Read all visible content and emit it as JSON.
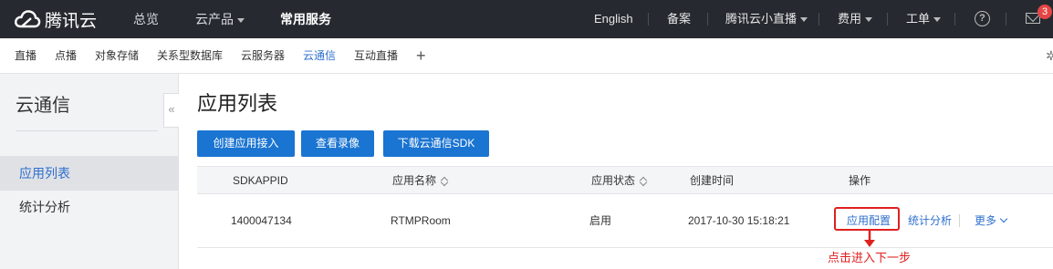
{
  "topbar": {
    "brand": "腾讯云",
    "nav": [
      "总览",
      "云产品",
      "常用服务"
    ],
    "right": [
      "English",
      "备案",
      "腾讯云小直播",
      "费用",
      "工单"
    ],
    "mail_badge": "3"
  },
  "shortcuts": [
    "直播",
    "点播",
    "对象存储",
    "关系型数据库",
    "云服务器",
    "云通信",
    "互动直播"
  ],
  "sidebar": {
    "title": "云通信",
    "items": [
      "应用列表",
      "统计分析"
    ],
    "collapse": "«"
  },
  "main": {
    "title": "应用列表",
    "buttons": [
      "创建应用接入",
      "查看录像",
      "下载云通信SDK"
    ]
  },
  "table": {
    "headers": [
      "SDKAPPID",
      "应用名称",
      "应用状态",
      "创建时间",
      "操作"
    ],
    "rows": [
      {
        "sdkappid": "1400047134",
        "name": "RTMPRoom",
        "status": "启用",
        "created": "2017-10-30 15:18:21",
        "actions": [
          "应用配置",
          "统计分析",
          "更多"
        ]
      }
    ]
  },
  "annotation": "点击进入下一步",
  "colors": {
    "accent": "#1a74d1",
    "highlight": "#e02020",
    "topbar": "#262a30"
  }
}
